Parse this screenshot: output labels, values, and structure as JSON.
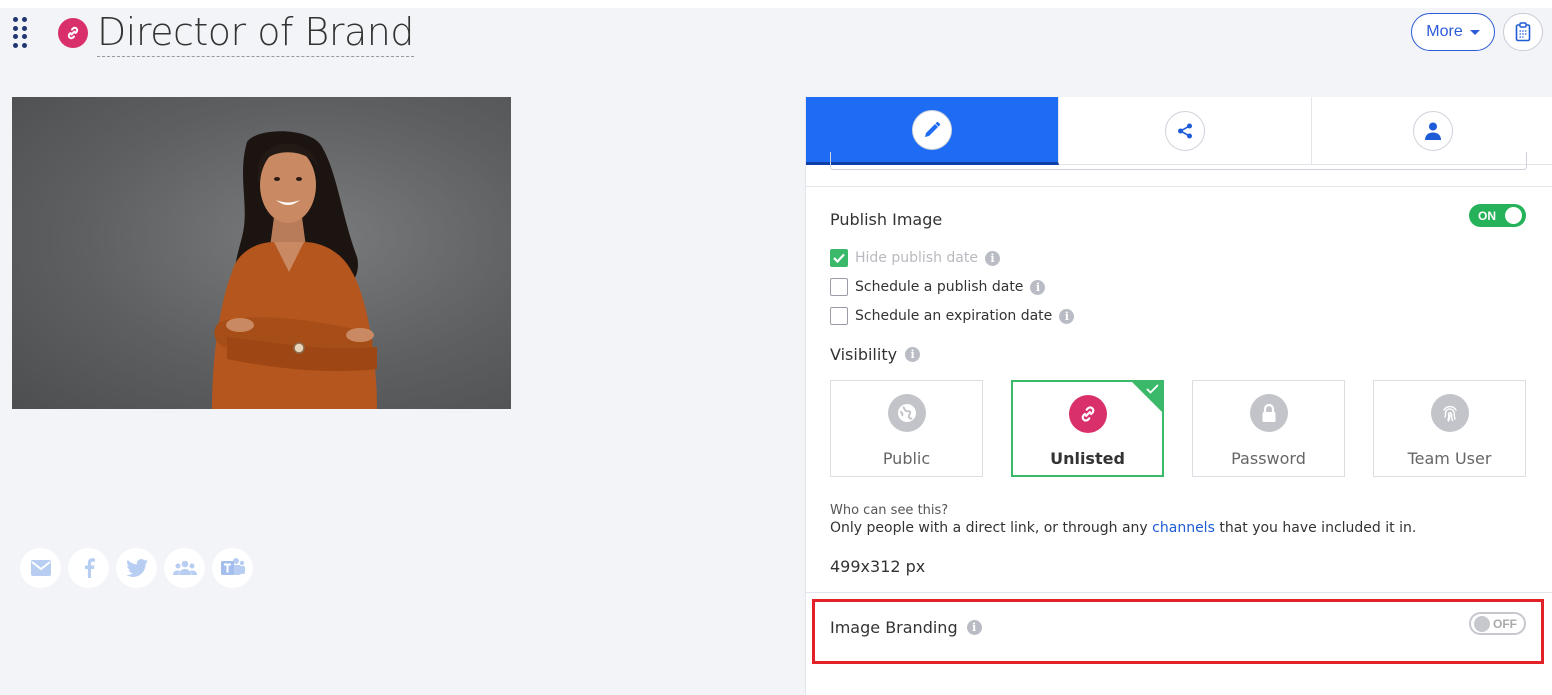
{
  "header": {
    "title": "Director of Brand",
    "more_label": "More"
  },
  "social": [
    "email-icon",
    "facebook-icon",
    "twitter-icon",
    "people-icon",
    "teams-icon"
  ],
  "tabs": [
    "edit",
    "share",
    "user"
  ],
  "publish": {
    "label": "Publish Image",
    "toggle": "ON",
    "options": [
      {
        "label": "Hide publish date",
        "checked": true
      },
      {
        "label": "Schedule a publish date",
        "checked": false
      },
      {
        "label": "Schedule an expiration date",
        "checked": false
      }
    ]
  },
  "visibility": {
    "label": "Visibility",
    "options": [
      "Public",
      "Unlisted",
      "Password",
      "Team User"
    ],
    "selected": "Unlisted",
    "who_text": "Who can see this?",
    "desc_before": "Only people with a direct link, or through any ",
    "desc_link": "channels",
    "desc_after": " that you have included it in."
  },
  "dimensions": "499x312 px",
  "branding": {
    "label": "Image Branding",
    "toggle": "OFF"
  },
  "info_glyph": "i",
  "colors": {
    "accent": "#1e6cf4",
    "pink": "#d9306b",
    "green": "#26b25a",
    "highlight": "#e32128"
  }
}
